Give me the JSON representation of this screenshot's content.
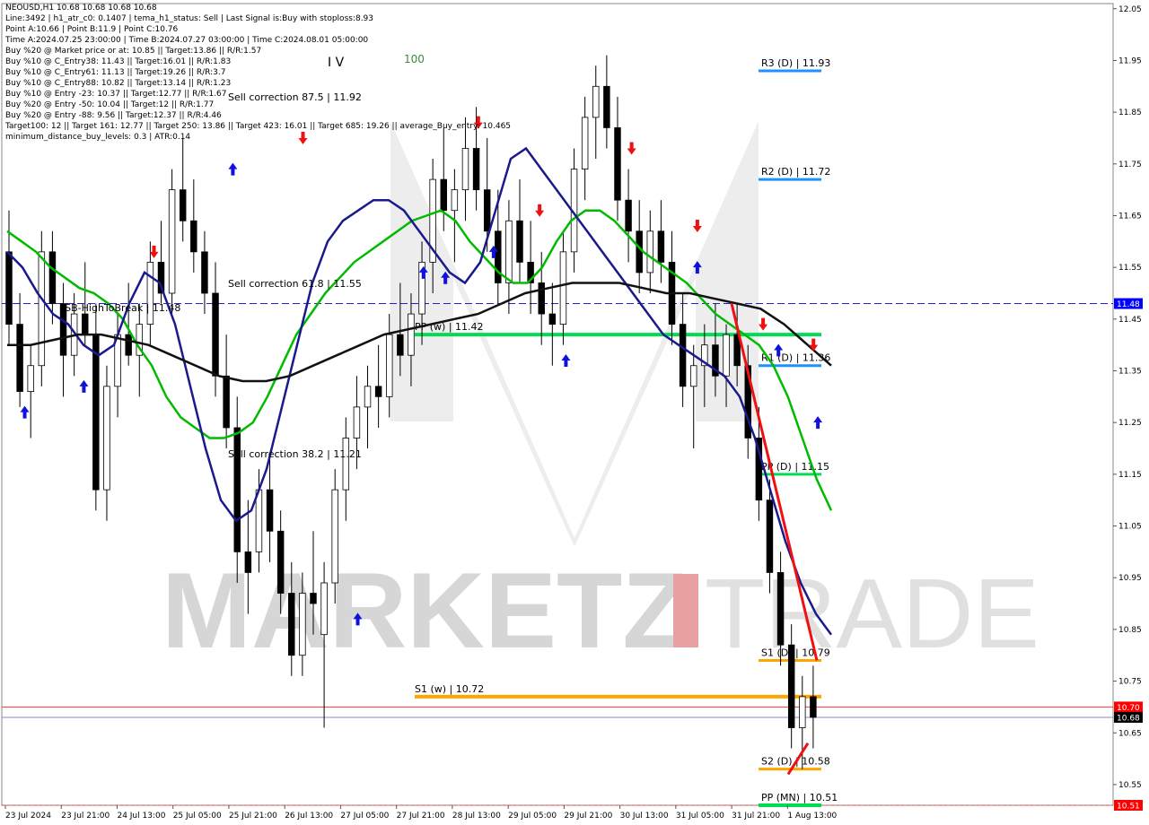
{
  "header": {
    "lines": [
      "NEOUSD,H1  10.68 10.68 10.68 10.68",
      "Line:3492 | h1_atr_c0: 0.1407 | tema_h1_status: Sell | Last Signal is:Buy with stoploss:8.93",
      "Point A:10.66 | Point B:11.9 | Point C:10.76",
      "Time A:2024.07.25 23:00:00 | Time B:2024.07.27 03:00:00 | Time C:2024.08.01 05:00:00",
      "Buy %20 @ Market price or at: 10.85 || Target:13.86 || R/R:1.57",
      "Buy %10 @ C_Entry38: 11.43 || Target:16.01 || R/R:1.83",
      "Buy %10 @ C_Entry61: 11.13 || Target:19.26 || R/R:3.7",
      "Buy %10 @ C_Entry88: 10.82 || Target:13.14 || R/R:1.23",
      "Buy %10 @ Entry -23: 10.37 || Target:12.77 || R/R:1.67",
      "Buy %20 @ Entry -50: 10.04 || Target:12 || R/R:1.77",
      "Buy %20 @ Entry -88: 9.56 || Target:12.37 || R/R:4.46",
      "Target100: 12 || Target 161: 12.77 || Target 250: 13.86 || Target 423: 16.01 || Target 685: 19.26 || average_Buy_entry: 10.465",
      "minimum_distance_buy_levels: 0.3 | ATR:0.14"
    ]
  },
  "watermark": {
    "left": "MARKETZ",
    "right": "TRADE"
  },
  "chart_data": {
    "type": "candlestick",
    "symbol": "NEOUSD",
    "timeframe": "H1",
    "ylim": [
      10.51,
      12.06
    ],
    "y_ticks": [
      "12.05",
      "11.95",
      "11.85",
      "11.75",
      "11.65",
      "11.55",
      "11.45",
      "11.35",
      "11.25",
      "11.15",
      "11.05",
      "10.95",
      "10.85",
      "10.75",
      "10.65",
      "10.55"
    ],
    "x_labels": [
      "23 Jul 2024",
      "23 Jul 21:00",
      "24 Jul 13:00",
      "25 Jul 05:00",
      "25 Jul 21:00",
      "26 Jul 13:00",
      "27 Jul 05:00",
      "27 Jul 21:00",
      "28 Jul 13:00",
      "29 Jul 05:00",
      "29 Jul 21:00",
      "30 Jul 13:00",
      "31 Jul 05:00",
      "31 Jul 21:00",
      "1 Aug 13:00"
    ],
    "price_tags": [
      {
        "value": 11.48,
        "label": "11.48",
        "color": "#0000ff"
      },
      {
        "value": 10.7,
        "label": "10.70",
        "color": "#ff0000"
      },
      {
        "value": 10.68,
        "label": "10.68",
        "color": "#000000"
      },
      {
        "value": 10.51,
        "label": "10.51",
        "color": "#ff0000"
      }
    ],
    "levels": [
      {
        "label": "R3 (D) | 11.93",
        "value": 11.93,
        "color": "#1e90ff"
      },
      {
        "label": "R2 (D) | 11.72",
        "value": 11.72,
        "color": "#1e90ff"
      },
      {
        "label": "R1 (D) | 11.36",
        "value": 11.36,
        "color": "#1e90ff"
      },
      {
        "label": "PP (D) | 11.15",
        "value": 11.15,
        "color": "#00dd55"
      },
      {
        "label": "S1 (D) | 10.79",
        "value": 10.79,
        "color": "#ffa500"
      },
      {
        "label": "S2 (D) | 10.58",
        "value": 10.58,
        "color": "#ffa500"
      },
      {
        "label": "PP (MN) | 10.51",
        "value": 10.51,
        "color": "#00dd55"
      },
      {
        "label": "PP (w) | 11.42",
        "value": 11.42,
        "color": "#00dd55"
      },
      {
        "label": "S1 (w) | 10.72",
        "value": 10.72,
        "color": "#ffa500"
      }
    ],
    "annotations": [
      {
        "text": "Sell correction 87.5 | 11.92",
        "value": 11.92
      },
      {
        "text": "Sell correction 61.8 | 11.55",
        "value": 11.55
      },
      {
        "text": "Sell correction 38.2 | 11.21",
        "value": 11.21
      },
      {
        "text": "FSB-HighToBreak | 11.48",
        "value": 11.48
      },
      {
        "text": "I V",
        "value": 12.0
      },
      {
        "text": "100",
        "value": 12.0
      }
    ],
    "candles": [
      [
        11.58,
        11.66,
        11.4,
        11.44
      ],
      [
        11.44,
        11.5,
        11.28,
        11.31
      ],
      [
        11.31,
        11.4,
        11.22,
        11.36
      ],
      [
        11.36,
        11.62,
        11.32,
        11.58
      ],
      [
        11.58,
        11.62,
        11.44,
        11.48
      ],
      [
        11.48,
        11.52,
        11.3,
        11.38
      ],
      [
        11.38,
        11.5,
        11.34,
        11.46
      ],
      [
        11.46,
        11.56,
        11.4,
        11.42
      ],
      [
        11.42,
        11.48,
        11.08,
        11.12
      ],
      [
        11.12,
        11.36,
        11.06,
        11.32
      ],
      [
        11.32,
        11.46,
        11.26,
        11.42
      ],
      [
        11.42,
        11.52,
        11.36,
        11.38
      ],
      [
        11.38,
        11.48,
        11.3,
        11.44
      ],
      [
        11.44,
        11.6,
        11.4,
        11.56
      ],
      [
        11.56,
        11.64,
        11.48,
        11.5
      ],
      [
        11.5,
        11.74,
        11.46,
        11.7
      ],
      [
        11.7,
        11.8,
        11.6,
        11.64
      ],
      [
        11.64,
        11.72,
        11.54,
        11.58
      ],
      [
        11.58,
        11.62,
        11.46,
        11.5
      ],
      [
        11.5,
        11.56,
        11.3,
        11.34
      ],
      [
        11.34,
        11.42,
        11.2,
        11.24
      ],
      [
        11.24,
        11.3,
        10.94,
        11.0
      ],
      [
        11.0,
        11.1,
        10.88,
        10.96
      ],
      [
        11.0,
        11.16,
        10.96,
        11.12
      ],
      [
        11.12,
        11.18,
        10.98,
        11.04
      ],
      [
        11.04,
        11.08,
        10.88,
        10.92
      ],
      [
        10.92,
        10.98,
        10.76,
        10.8
      ],
      [
        10.8,
        10.96,
        10.76,
        10.92
      ],
      [
        10.92,
        11.04,
        10.84,
        10.9
      ],
      [
        10.84,
        10.98,
        10.66,
        10.94
      ],
      [
        10.94,
        11.16,
        10.9,
        11.12
      ],
      [
        11.12,
        11.26,
        11.06,
        11.22
      ],
      [
        11.22,
        11.34,
        11.16,
        11.28
      ],
      [
        11.28,
        11.36,
        11.2,
        11.32
      ],
      [
        11.32,
        11.4,
        11.24,
        11.3
      ],
      [
        11.3,
        11.46,
        11.26,
        11.42
      ],
      [
        11.42,
        11.52,
        11.34,
        11.38
      ],
      [
        11.38,
        11.5,
        11.32,
        11.46
      ],
      [
        11.46,
        11.6,
        11.4,
        11.56
      ],
      [
        11.56,
        11.76,
        11.5,
        11.72
      ],
      [
        11.72,
        11.82,
        11.62,
        11.66
      ],
      [
        11.66,
        11.74,
        11.56,
        11.7
      ],
      [
        11.7,
        11.84,
        11.64,
        11.78
      ],
      [
        11.78,
        11.86,
        11.66,
        11.7
      ],
      [
        11.7,
        11.8,
        11.58,
        11.62
      ],
      [
        11.62,
        11.7,
        11.48,
        11.52
      ],
      [
        11.52,
        11.68,
        11.46,
        11.64
      ],
      [
        11.64,
        11.72,
        11.52,
        11.56
      ],
      [
        11.56,
        11.64,
        11.46,
        11.52
      ],
      [
        11.52,
        11.58,
        11.4,
        11.46
      ],
      [
        11.46,
        11.52,
        11.36,
        11.44
      ],
      [
        11.44,
        11.62,
        11.4,
        11.58
      ],
      [
        11.58,
        11.78,
        11.54,
        11.74
      ],
      [
        11.74,
        11.88,
        11.68,
        11.84
      ],
      [
        11.84,
        11.94,
        11.76,
        11.9
      ],
      [
        11.9,
        11.96,
        11.78,
        11.82
      ],
      [
        11.82,
        11.88,
        11.64,
        11.68
      ],
      [
        11.68,
        11.74,
        11.56,
        11.62
      ],
      [
        11.62,
        11.68,
        11.5,
        11.54
      ],
      [
        11.54,
        11.66,
        11.5,
        11.62
      ],
      [
        11.62,
        11.68,
        11.52,
        11.56
      ],
      [
        11.56,
        11.62,
        11.4,
        11.44
      ],
      [
        11.44,
        11.5,
        11.28,
        11.32
      ],
      [
        11.32,
        11.4,
        11.2,
        11.36
      ],
      [
        11.36,
        11.44,
        11.28,
        11.4
      ],
      [
        11.4,
        11.48,
        11.3,
        11.34
      ],
      [
        11.34,
        11.44,
        11.28,
        11.42
      ],
      [
        11.42,
        11.48,
        11.32,
        11.36
      ],
      [
        11.36,
        11.4,
        11.18,
        11.22
      ],
      [
        11.22,
        11.28,
        11.06,
        11.1
      ],
      [
        11.1,
        11.14,
        10.92,
        10.96
      ],
      [
        10.96,
        11.0,
        10.78,
        10.82
      ],
      [
        10.82,
        10.86,
        10.62,
        10.66
      ],
      [
        10.66,
        10.76,
        10.58,
        10.72
      ],
      [
        10.72,
        10.78,
        10.62,
        10.68
      ]
    ],
    "series": [
      {
        "name": "",
        "color": "#00bb00",
        "values": [
          11.62,
          11.6,
          11.58,
          11.55,
          11.53,
          11.51,
          11.5,
          11.48,
          11.45,
          11.4,
          11.36,
          11.3,
          11.26,
          11.24,
          11.22,
          11.22,
          11.23,
          11.25,
          11.3,
          11.36,
          11.42,
          11.46,
          11.5,
          11.53,
          11.56,
          11.58,
          11.6,
          11.62,
          11.64,
          11.65,
          11.66,
          11.64,
          11.6,
          11.57,
          11.54,
          11.52,
          11.52,
          11.55,
          11.6,
          11.64,
          11.66,
          11.66,
          11.64,
          11.61,
          11.58,
          11.56,
          11.54,
          11.52,
          11.49,
          11.46,
          11.44,
          11.42,
          11.4,
          11.36,
          11.3,
          11.22,
          11.14,
          11.08
        ]
      },
      {
        "name": "",
        "color": "#1a1a8c",
        "values": [
          11.58,
          11.55,
          11.5,
          11.46,
          11.44,
          11.4,
          11.38,
          11.4,
          11.48,
          11.54,
          11.52,
          11.44,
          11.32,
          11.2,
          11.1,
          11.06,
          11.08,
          11.16,
          11.28,
          11.4,
          11.52,
          11.6,
          11.64,
          11.66,
          11.68,
          11.68,
          11.66,
          11.62,
          11.58,
          11.54,
          11.52,
          11.56,
          11.66,
          11.76,
          11.78,
          11.74,
          11.7,
          11.66,
          11.62,
          11.58,
          11.54,
          11.5,
          11.46,
          11.42,
          11.4,
          11.38,
          11.36,
          11.34,
          11.3,
          11.22,
          11.12,
          11.02,
          10.94,
          10.88,
          10.84
        ]
      },
      {
        "name": "",
        "color": "#111111",
        "values": [
          11.4,
          11.4,
          11.41,
          11.42,
          11.42,
          11.41,
          11.4,
          11.38,
          11.36,
          11.34,
          11.33,
          11.33,
          11.34,
          11.36,
          11.38,
          11.4,
          11.42,
          11.43,
          11.44,
          11.45,
          11.46,
          11.48,
          11.5,
          11.51,
          11.52,
          11.52,
          11.52,
          11.51,
          11.5,
          11.5,
          11.49,
          11.48,
          11.47,
          11.44,
          11.4,
          11.36
        ]
      }
    ],
    "signals": [
      {
        "type": "buy",
        "x": 8,
        "y": 11.27
      },
      {
        "type": "buy",
        "x": 35,
        "y": 11.32
      },
      {
        "type": "sell",
        "x": 67,
        "y": 11.58
      },
      {
        "type": "buy",
        "x": 103,
        "y": 11.74
      },
      {
        "type": "sell",
        "x": 135,
        "y": 11.8
      },
      {
        "type": "buy",
        "x": 160,
        "y": 10.87
      },
      {
        "type": "buy",
        "x": 190,
        "y": 11.54
      },
      {
        "type": "buy",
        "x": 200,
        "y": 11.53
      },
      {
        "type": "sell",
        "x": 215,
        "y": 11.83
      },
      {
        "type": "buy",
        "x": 222,
        "y": 11.58
      },
      {
        "type": "sell",
        "x": 243,
        "y": 11.66
      },
      {
        "type": "buy",
        "x": 255,
        "y": 11.37
      },
      {
        "type": "sell",
        "x": 285,
        "y": 11.78
      },
      {
        "type": "sell",
        "x": 315,
        "y": 11.63
      },
      {
        "type": "buy",
        "x": 315,
        "y": 11.55
      },
      {
        "type": "sell",
        "x": 345,
        "y": 11.44
      },
      {
        "type": "buy",
        "x": 352,
        "y": 11.39
      },
      {
        "type": "sell",
        "x": 368,
        "y": 11.4
      },
      {
        "type": "buy",
        "x": 370,
        "y": 11.25
      }
    ]
  }
}
